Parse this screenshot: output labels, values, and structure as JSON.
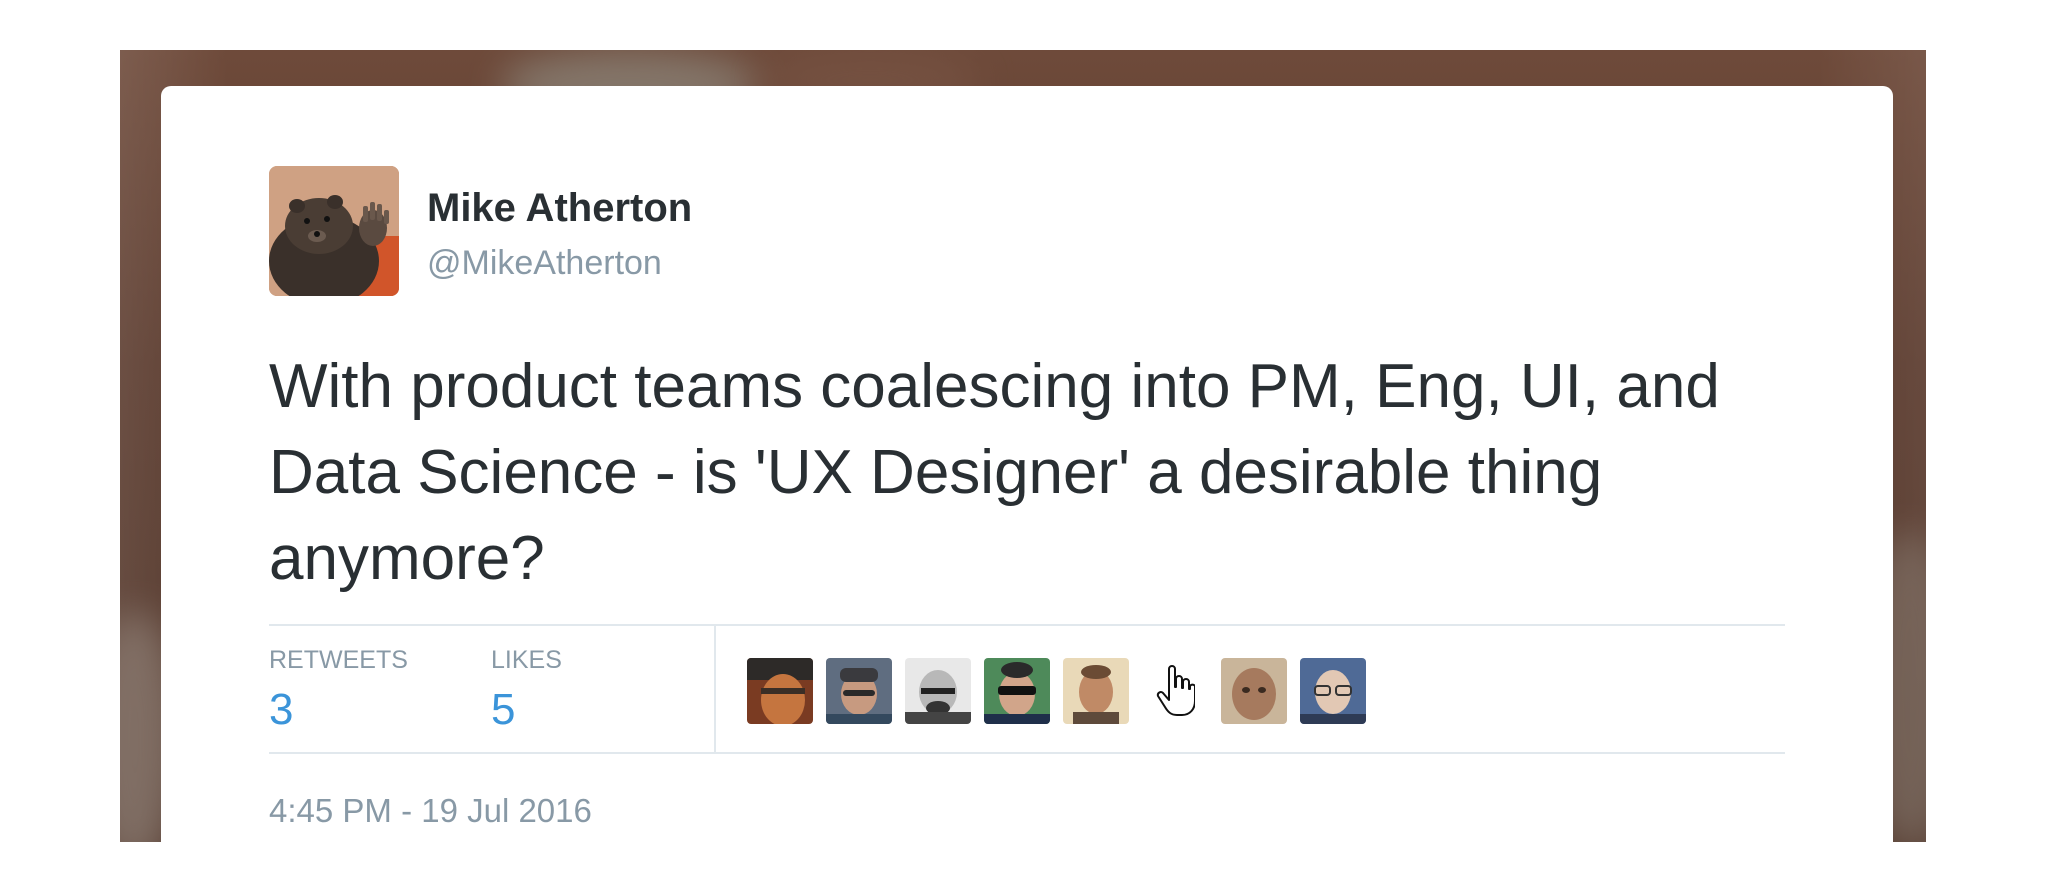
{
  "author": {
    "name": "Mike Atherton",
    "handle": "@MikeAtherton"
  },
  "tweet": {
    "text": "With product teams coalescing into PM, Eng, UI, and Data Science - is 'UX Designer' a desirable thing anymore?",
    "timestamp": "4:45 PM - 19 Jul 2016"
  },
  "stats": {
    "retweets_label": "RETWEETS",
    "retweets_count": "3",
    "likes_label": "LIKES",
    "likes_count": "5"
  },
  "likers": {
    "count_shown": 8
  },
  "icons": {
    "cursor": "hand-pointer-icon"
  },
  "colors": {
    "text_primary": "#292f33",
    "text_secondary": "#8899a6",
    "stat_value": "#3b94d9",
    "divider": "#e1e8ed",
    "card_bg": "#ffffff",
    "backdrop": "#5b3b2e"
  }
}
